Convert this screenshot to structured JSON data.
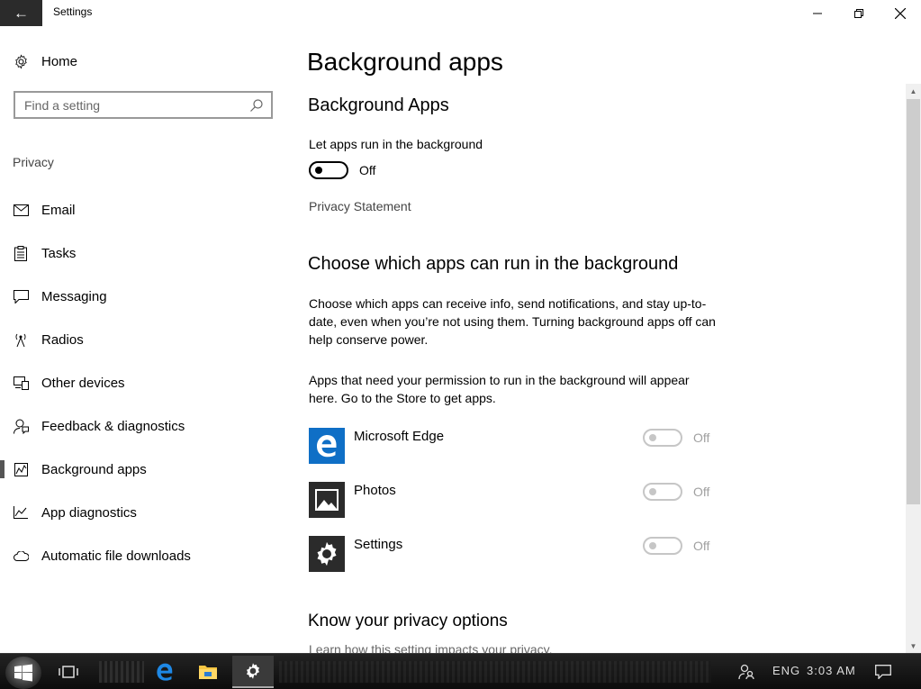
{
  "window": {
    "title": "Settings",
    "back_glyph": "←",
    "min_glyph": "—",
    "max_glyph": "❐",
    "close_glyph": "✕"
  },
  "sidebar": {
    "home_label": "Home",
    "home_icon": "gear-icon",
    "search_placeholder": "Find a setting",
    "section_label": "Privacy",
    "items": [
      {
        "label": "Email",
        "icon": "mail-icon",
        "active": false
      },
      {
        "label": "Tasks",
        "icon": "clipboard-icon",
        "active": false
      },
      {
        "label": "Messaging",
        "icon": "chat-icon",
        "active": false
      },
      {
        "label": "Radios",
        "icon": "antenna-icon",
        "active": false
      },
      {
        "label": "Other devices",
        "icon": "devices-icon",
        "active": false
      },
      {
        "label": "Feedback & diagnostics",
        "icon": "feedback-icon",
        "active": false
      },
      {
        "label": "Background apps",
        "icon": "background-apps-icon",
        "active": true
      },
      {
        "label": "App diagnostics",
        "icon": "chart-icon",
        "active": false
      },
      {
        "label": "Automatic file downloads",
        "icon": "cloud-icon",
        "active": false
      }
    ]
  },
  "main": {
    "page_title": "Background apps",
    "section1_heading": "Background Apps",
    "let_apps_label": "Let apps run in the background",
    "master_toggle_state": "Off",
    "privacy_link": "Privacy Statement",
    "section2_heading": "Choose which apps can run in the background",
    "description": "Choose which apps can receive info, send notifications, and stay up-to-date, even when you’re not using them. Turning background apps off can help conserve power.",
    "permission_text": "Apps that need your permission to run in the background will appear here. Go to the Store to get apps.",
    "apps": [
      {
        "name": "Microsoft Edge",
        "state": "Off",
        "icon": "edge-icon",
        "icon_bg": "#0f6fc6"
      },
      {
        "name": "Photos",
        "state": "Off",
        "icon": "photos-icon",
        "icon_bg": "#2b2b2b"
      },
      {
        "name": "Settings",
        "state": "Off",
        "icon": "settings-gear-icon",
        "icon_bg": "#2b2b2b"
      }
    ],
    "section3_heading": "Know your privacy options",
    "section3_text": "Learn how this setting impacts your privacy."
  },
  "taskbar": {
    "language": "ENG",
    "time": "3:03 AM"
  },
  "colors": {
    "edge_blue": "#0f6fc6",
    "disabled_toggle": "#c6c6c6",
    "taskbar": "#151515"
  }
}
